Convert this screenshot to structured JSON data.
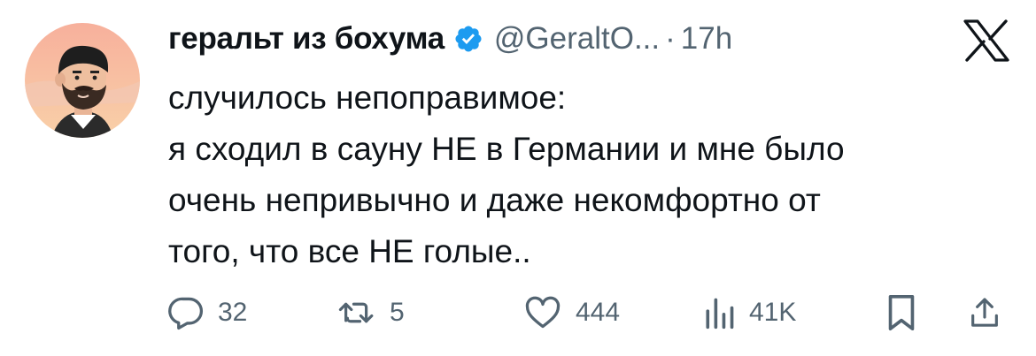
{
  "tweet": {
    "author_name": "геральт из бохума",
    "handle": "@GeraltO...",
    "separator": "·",
    "time": "17h",
    "lines": [
      "случилось непоправимое:",
      "я сходил в сауну НЕ в Германии и мне было",
      "очень непривычно и даже некомфортно от",
      "того, что все НЕ голые.."
    ]
  },
  "actions": {
    "replies": "32",
    "reposts": "5",
    "likes": "444",
    "views": "41K"
  },
  "colors": {
    "text": "#0f1419",
    "muted": "#536471",
    "verified": "#1d9bf0",
    "avatar_bg": "#f6b6a2"
  },
  "icons": {
    "verified": "verified-badge-icon",
    "logo": "x-logo-icon",
    "reply": "reply-icon",
    "repost": "repost-icon",
    "like": "heart-icon",
    "views": "views-icon",
    "bookmark": "bookmark-icon",
    "share": "share-icon"
  }
}
